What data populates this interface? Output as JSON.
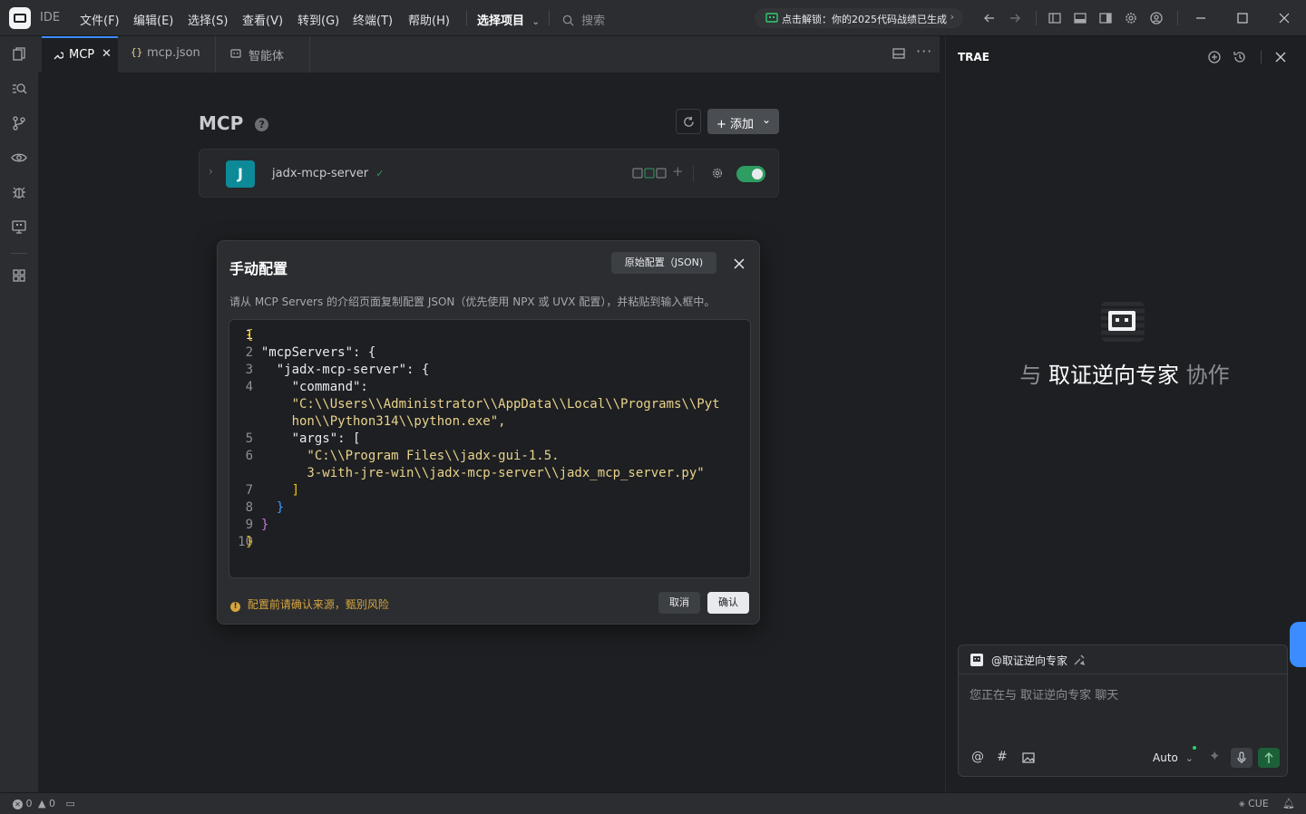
{
  "titlebar": {
    "app_name": "IDE",
    "menus": [
      "文件(F)",
      "编辑(E)",
      "选择(S)",
      "查看(V)",
      "转到(G)",
      "终端(T)",
      "帮助(H)"
    ],
    "project_selector": "选择项目",
    "search_placeholder": "搜索",
    "unlock_banner": "点击解锁：你的2025代码战绩已生成"
  },
  "tabs": [
    {
      "label": "MCP",
      "icon": "wrench-icon",
      "active": true
    },
    {
      "label": "mcp.json",
      "icon": "braces-icon",
      "active": false
    },
    {
      "label": "智能体",
      "icon": "robot-icon",
      "active": false
    }
  ],
  "mcp": {
    "title": "MCP",
    "add_label": "+ 添加",
    "server": {
      "avatar_letter": "J",
      "name": "jadx-mcp-server",
      "status_mark": "✓"
    }
  },
  "dialog": {
    "title": "手动配置",
    "raw_button": "原始配置（JSON)",
    "description": "请从 MCP Servers 的介绍页面复制配置 JSON（优先使用 NPX 或 UVX 配置），并粘贴到输入框中。",
    "warning": "配置前请确认来源，甄别风险",
    "cancel_label": "取消",
    "confirm_label": "确认",
    "code": {
      "line_numbers": [
        "1",
        "2",
        "3",
        "4",
        "",
        "",
        "5",
        "6",
        "",
        "7",
        "8",
        "9",
        "10"
      ],
      "lines": [
        "{",
        "  \"mcpServers\": {",
        "    \"jadx-mcp-server\": {",
        "      \"command\":",
        "      \"C:\\\\Users\\\\Administrator\\\\AppData\\\\Local\\\\Programs\\\\Pyt",
        "      hon\\\\Python314\\\\python.exe\",",
        "      \"args\": [",
        "        \"C:\\\\Program Files\\\\jadx-gui-1.5.",
        "        3-with-jre-win\\\\jadx-mcp-server\\\\jadx_mcp_server.py\"",
        "      ]",
        "    }",
        "  }",
        "}"
      ]
    }
  },
  "rightpanel": {
    "label": "TRAE",
    "collab_prefix": "与",
    "agent_name": "取证逆向专家",
    "collab_suffix": "协作",
    "chat": {
      "mention": "@取证逆向专家",
      "placeholder": "您正在与 取证逆向专家 聊天",
      "model": "Auto"
    }
  },
  "statusbar": {
    "errors": "0",
    "warnings": "0",
    "cue": "CUE"
  },
  "colors": {
    "accent": "#3b8cff",
    "toggle_on": "#2d9d61",
    "server_avatar": "#0d8a97",
    "warning": "#d6a53f"
  }
}
